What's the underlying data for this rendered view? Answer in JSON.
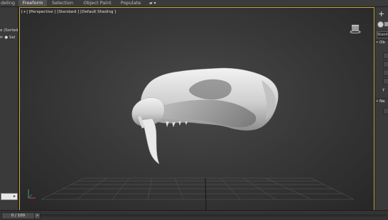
{
  "ribbon": {
    "tabs": [
      {
        "label": "deling",
        "active": false
      },
      {
        "label": "Freeform",
        "active": true
      },
      {
        "label": "Selection",
        "active": false
      },
      {
        "label": "Object Paint",
        "active": false
      },
      {
        "label": "Populate",
        "active": false
      }
    ],
    "overflow_icon": "menu-dropdown-icon",
    "overflow_glyph": "▰ ▾"
  },
  "scene_explorer": {
    "sort_label": "e (Sorted",
    "sort_glyph": "▴",
    "item_label": "Sal",
    "item_prefix": "⊳ ●",
    "field_value": "",
    "field_glyph": "▸"
  },
  "viewport": {
    "label_plus": "[+]",
    "label_view": "[Perspective ]",
    "label_mode": "[Standard ]",
    "label_shading": "[Default Shading ]",
    "object_name": "sabertooth-skull",
    "border_color": "#c9a53d"
  },
  "command_panel": {
    "create_glyph": "+",
    "field_value": "Stand",
    "rollout_object_type": "• Ob",
    "rollout_name_color": "• Na",
    "button_label": "T"
  },
  "status": {
    "frame_counter": "0 / 100",
    "next_glyph": ">"
  }
}
